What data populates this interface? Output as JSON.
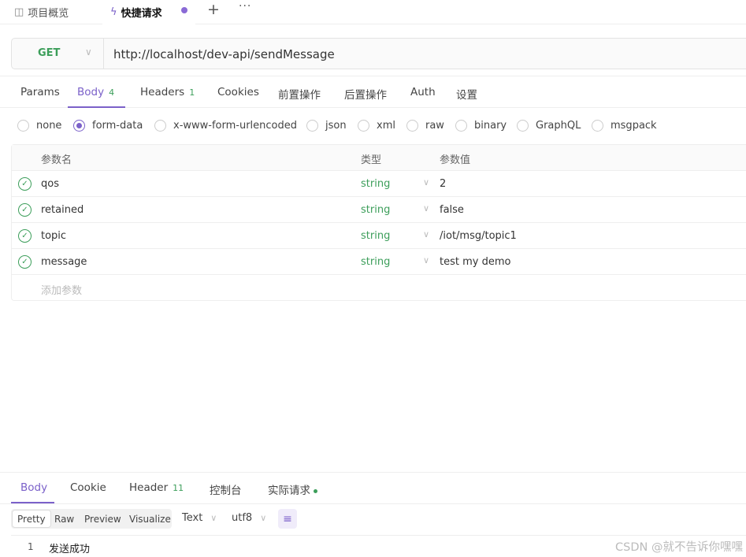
{
  "tabs": [
    {
      "icon": "overview-icon",
      "label": "项目概览"
    },
    {
      "icon": "lightning-icon",
      "label": "快捷请求"
    }
  ],
  "request": {
    "method": "GET",
    "url": "http://localhost/dev-api/sendMessage"
  },
  "request_tabs": [
    {
      "label": "Params",
      "count": ""
    },
    {
      "label": "Body",
      "count": "4"
    },
    {
      "label": "Headers",
      "count": "1"
    },
    {
      "label": "Cookies",
      "count": ""
    },
    {
      "label": "前置操作",
      "count": ""
    },
    {
      "label": "后置操作",
      "count": ""
    },
    {
      "label": "Auth",
      "count": ""
    },
    {
      "label": "设置",
      "count": ""
    }
  ],
  "active_request_tab": "Body",
  "body_types": [
    "none",
    "form-data",
    "x-www-form-urlencoded",
    "json",
    "xml",
    "raw",
    "binary",
    "GraphQL",
    "msgpack"
  ],
  "selected_body_type": "form-data",
  "params_table": {
    "headers": [
      "参数名",
      "类型",
      "参数值"
    ],
    "rows": [
      {
        "name": "qos",
        "type": "string",
        "value": "2"
      },
      {
        "name": "retained",
        "type": "string",
        "value": "false"
      },
      {
        "name": "topic",
        "type": "string",
        "value": "/iot/msg/topic1"
      },
      {
        "name": "message",
        "type": "string",
        "value": "test my demo"
      }
    ],
    "add_placeholder": "添加参数"
  },
  "response": {
    "tabs": [
      {
        "label": "Body",
        "count": ""
      },
      {
        "label": "Cookie",
        "count": ""
      },
      {
        "label": "Header",
        "count": "11"
      },
      {
        "label": "控制台",
        "count": ""
      },
      {
        "label": "实际请求",
        "count": ""
      }
    ],
    "view_modes": [
      "Pretty",
      "Raw",
      "Preview",
      "Visualize"
    ],
    "active_view_mode": "Pretty",
    "format": "Text",
    "encoding": "utf8",
    "lines": [
      {
        "num": "1",
        "text": "发送成功"
      }
    ]
  },
  "watermark": "CSDN @就不告诉你嘿嘿",
  "colors": {
    "accent": "#7b61c9",
    "success": "#3c9e5a"
  }
}
